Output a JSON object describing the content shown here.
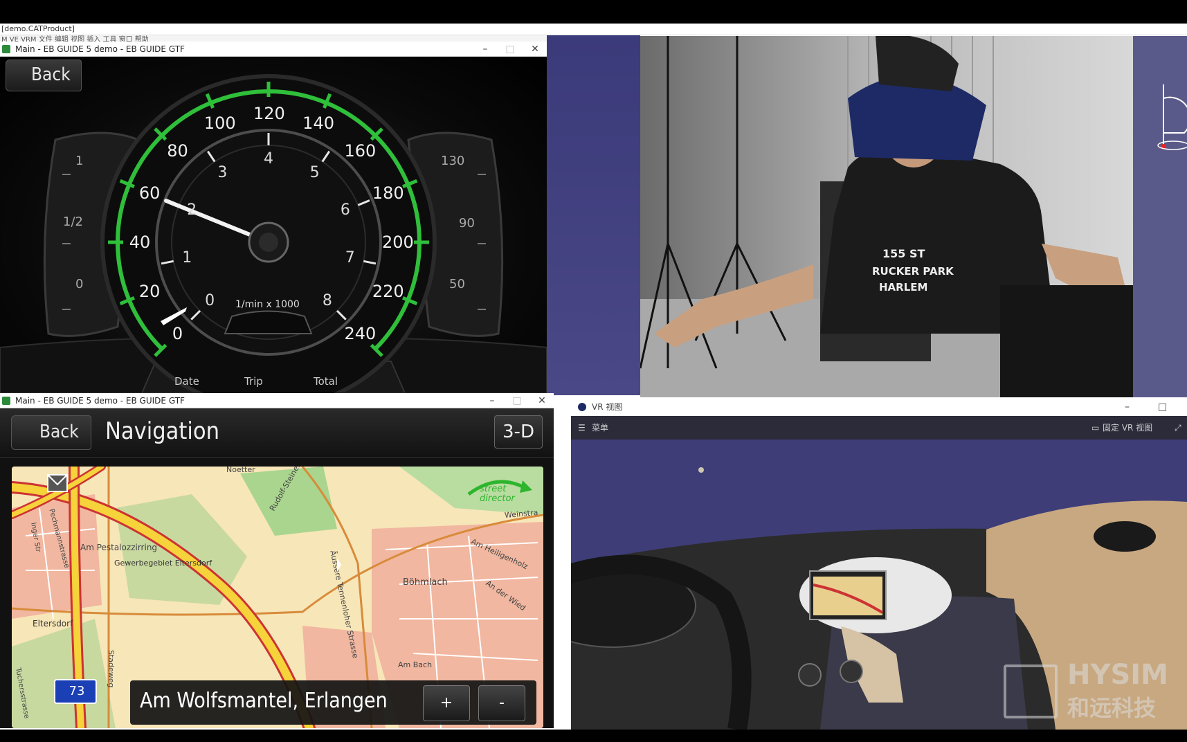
{
  "background_app": {
    "title": "[demo.CATProduct]",
    "menu": "M VE VRM  文件  编辑  视图  插入  工具  窗口  帮助"
  },
  "speedo_window": {
    "title": "Main - EB GUIDE 5 demo - EB GUIDE GTF",
    "back_label": "Back",
    "speed_ticks": [
      "0",
      "20",
      "40",
      "60",
      "80",
      "100",
      "120",
      "140",
      "160",
      "180",
      "200",
      "220",
      "240"
    ],
    "rpm_ticks": [
      "0",
      "1",
      "2",
      "3",
      "4",
      "5",
      "6",
      "7",
      "8"
    ],
    "rpm_unit": "1/min x 1000",
    "fuel_ticks": [
      "0",
      "1/2",
      "1"
    ],
    "temp_ticks": [
      "50",
      "90",
      "130"
    ],
    "tabs": [
      "Date",
      "Trip",
      "Total"
    ],
    "accent_color": "#2fbf3a"
  },
  "nav_window": {
    "title": "Main - EB GUIDE 5 demo - EB GUIDE GTF",
    "back_label": "Back",
    "heading": "Navigation",
    "view_mode_label": "3-D",
    "address": "Am Wolfsmantel, Erlangen",
    "zoom_in_label": "+",
    "zoom_out_label": "-",
    "map_labels": {
      "street_1": "Am Pestalozzirring",
      "place_1": "Gewerbegebiet Eltersdorf",
      "place_2": "Eltersdorf",
      "place_3": "Böhmlach",
      "street_2": "Am Heiligenholz",
      "street_3": "Äussere Tennenloher Strasse",
      "street_4": "Rudolf-Steiner",
      "street_5": "Weinstra",
      "street_6": "Am Bach",
      "street_7": "Stadeweg",
      "street_8": "An der Wied",
      "street_9": "Noetter",
      "street_10": "Pechmannstrasse",
      "street_11": "Inger Str",
      "street_12": "Tuchersstrasse",
      "route_number": "73",
      "brand": "street director"
    }
  },
  "vr_window": {
    "title": "VR 视图",
    "menu_label": "菜单",
    "fixed_view_label": "固定 VR 视图"
  },
  "watermark": {
    "name_en": "HYSIM",
    "name_cn": "和远科技"
  }
}
